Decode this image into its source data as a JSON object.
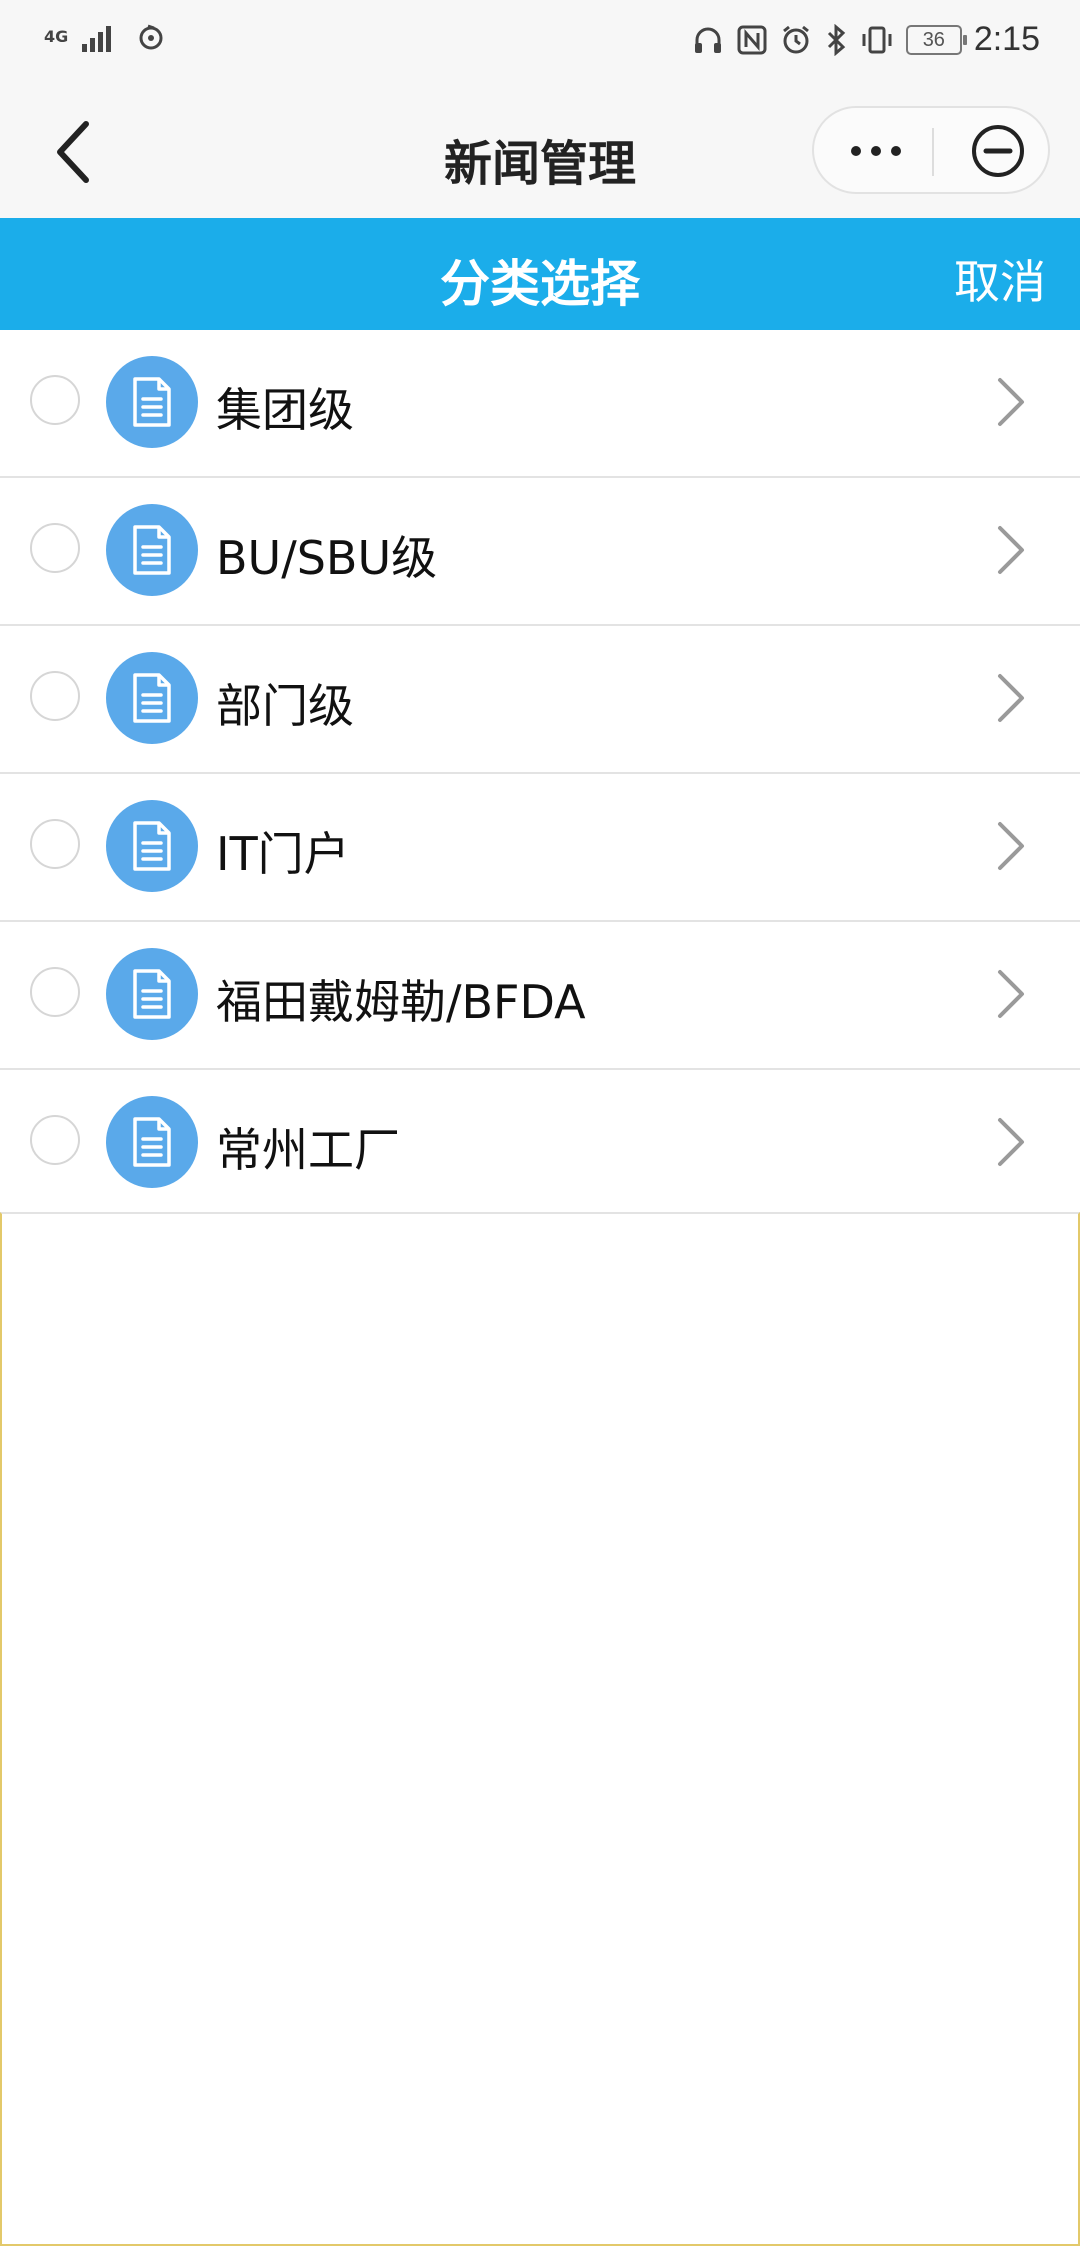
{
  "status_bar": {
    "time": "2:15",
    "battery": "36",
    "network": "4G"
  },
  "nav": {
    "title": "新闻管理"
  },
  "header": {
    "title": "分类选择",
    "cancel_label": "取消"
  },
  "categories": [
    {
      "label": "集团级",
      "selected": false
    },
    {
      "label": "BU/SBU级",
      "selected": false
    },
    {
      "label": "部门级",
      "selected": false
    },
    {
      "label": "IT门户",
      "selected": false
    },
    {
      "label": "福田戴姆勒/BFDA",
      "selected": false
    },
    {
      "label": "常州工厂",
      "selected": false
    }
  ],
  "colors": {
    "accent": "#1badea",
    "icon_circle": "#5aa9ea",
    "nav_background": "#f7f7f7"
  }
}
